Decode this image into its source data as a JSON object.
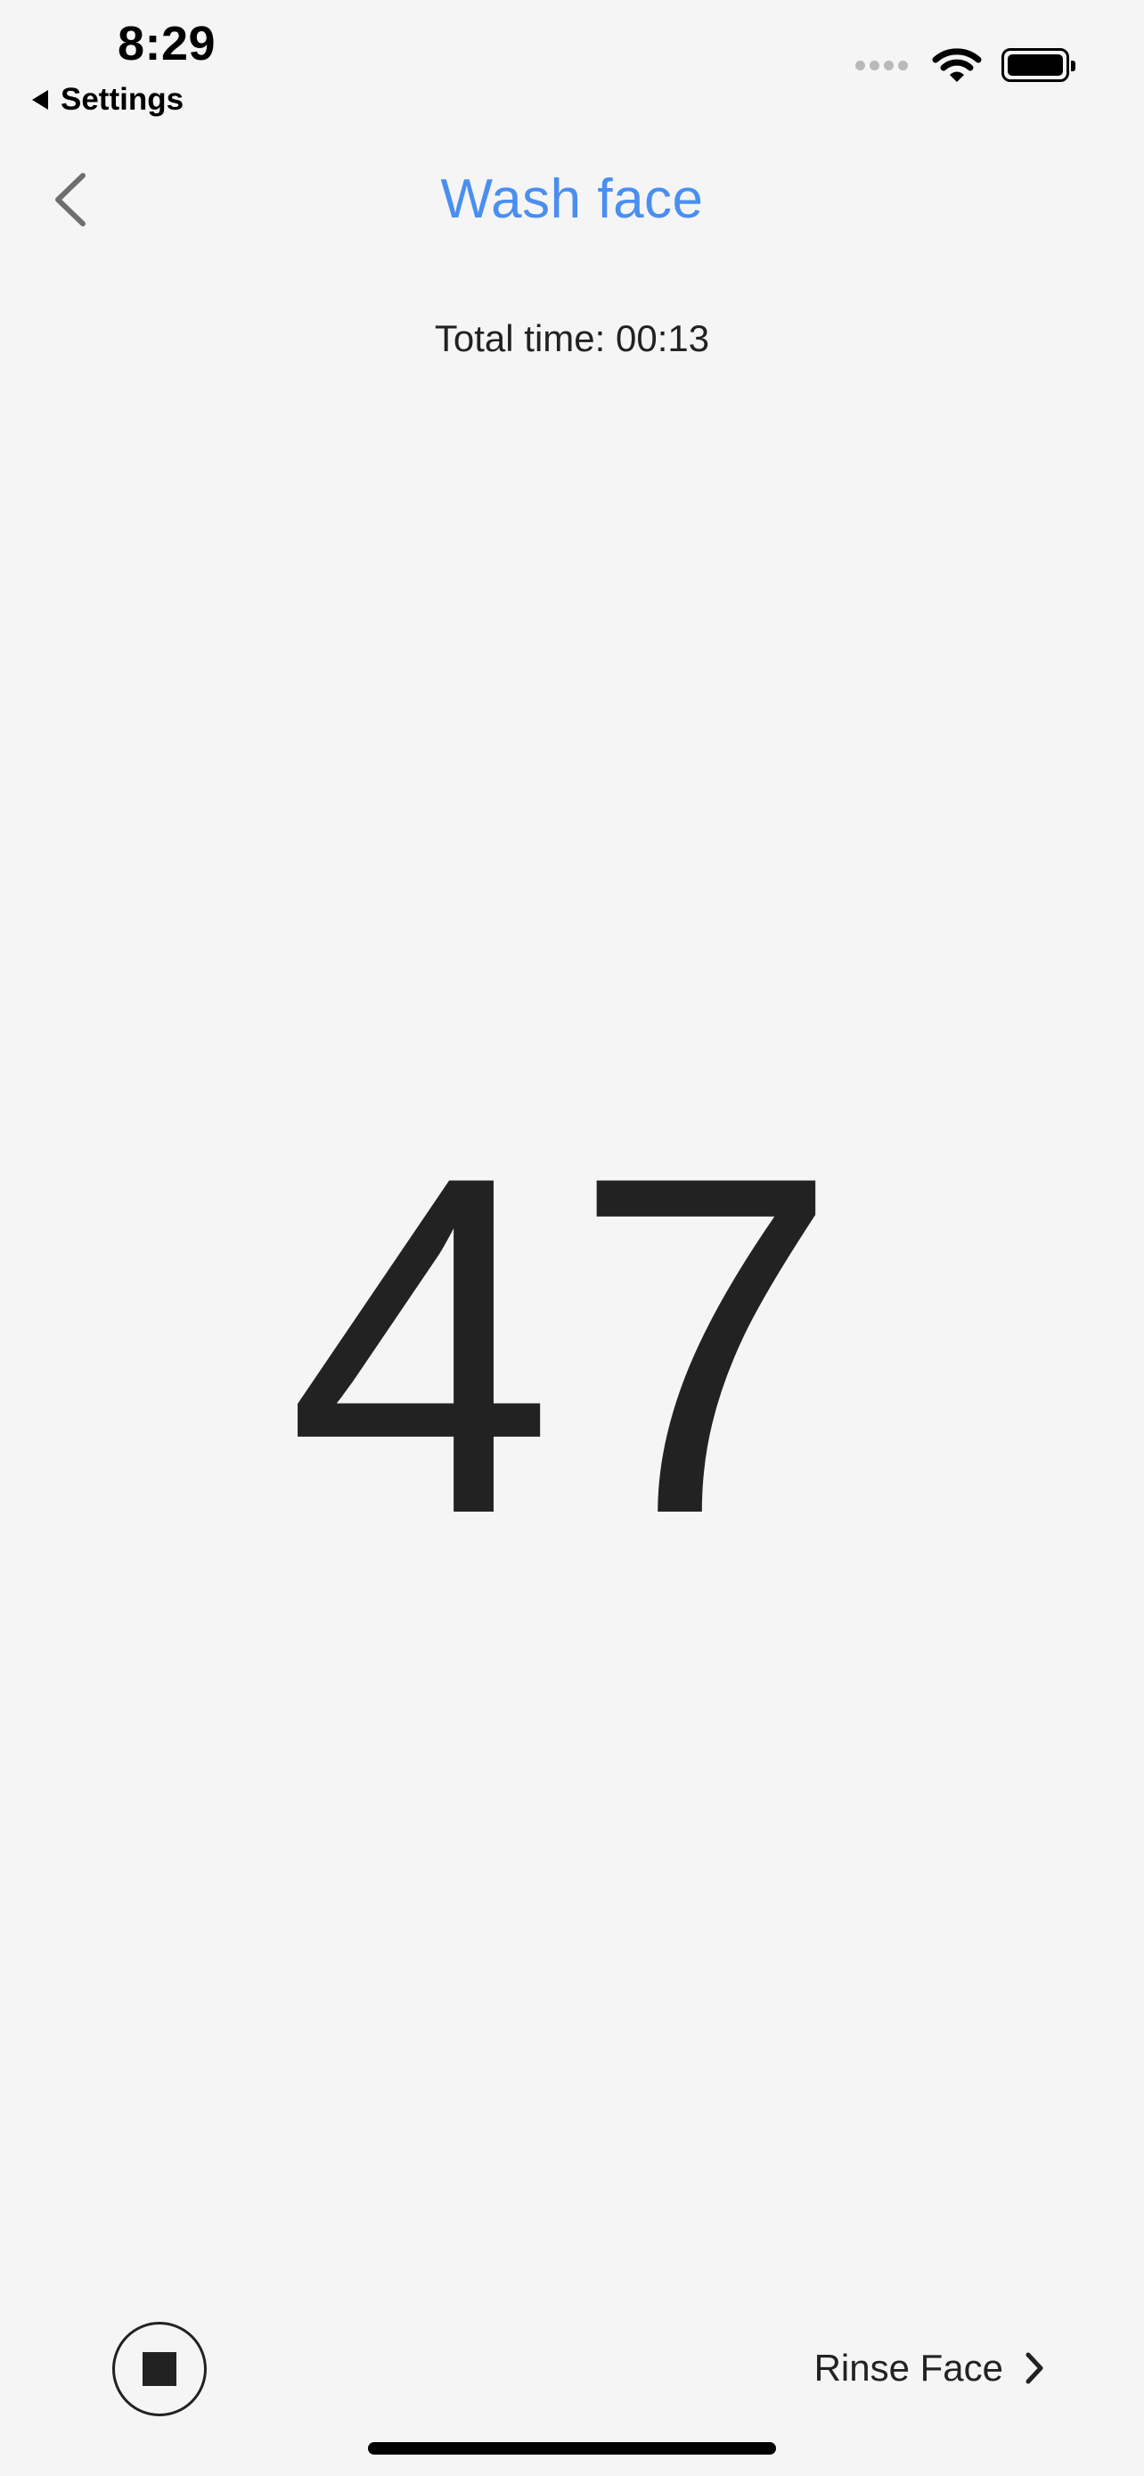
{
  "status_bar": {
    "time": "8:29",
    "back_app": "Settings"
  },
  "nav": {
    "title": "Wash face",
    "back_icon": "chevron-left-icon"
  },
  "timer": {
    "total_label": "Total time:",
    "total_value": "00:13",
    "countdown": "47"
  },
  "controls": {
    "stop_icon": "stop-icon",
    "next_label": "Rinse Face",
    "next_icon": "chevron-right-icon"
  },
  "colors": {
    "accent": "#4a8ff0",
    "text": "#222222",
    "background": "#f5f5f5"
  }
}
